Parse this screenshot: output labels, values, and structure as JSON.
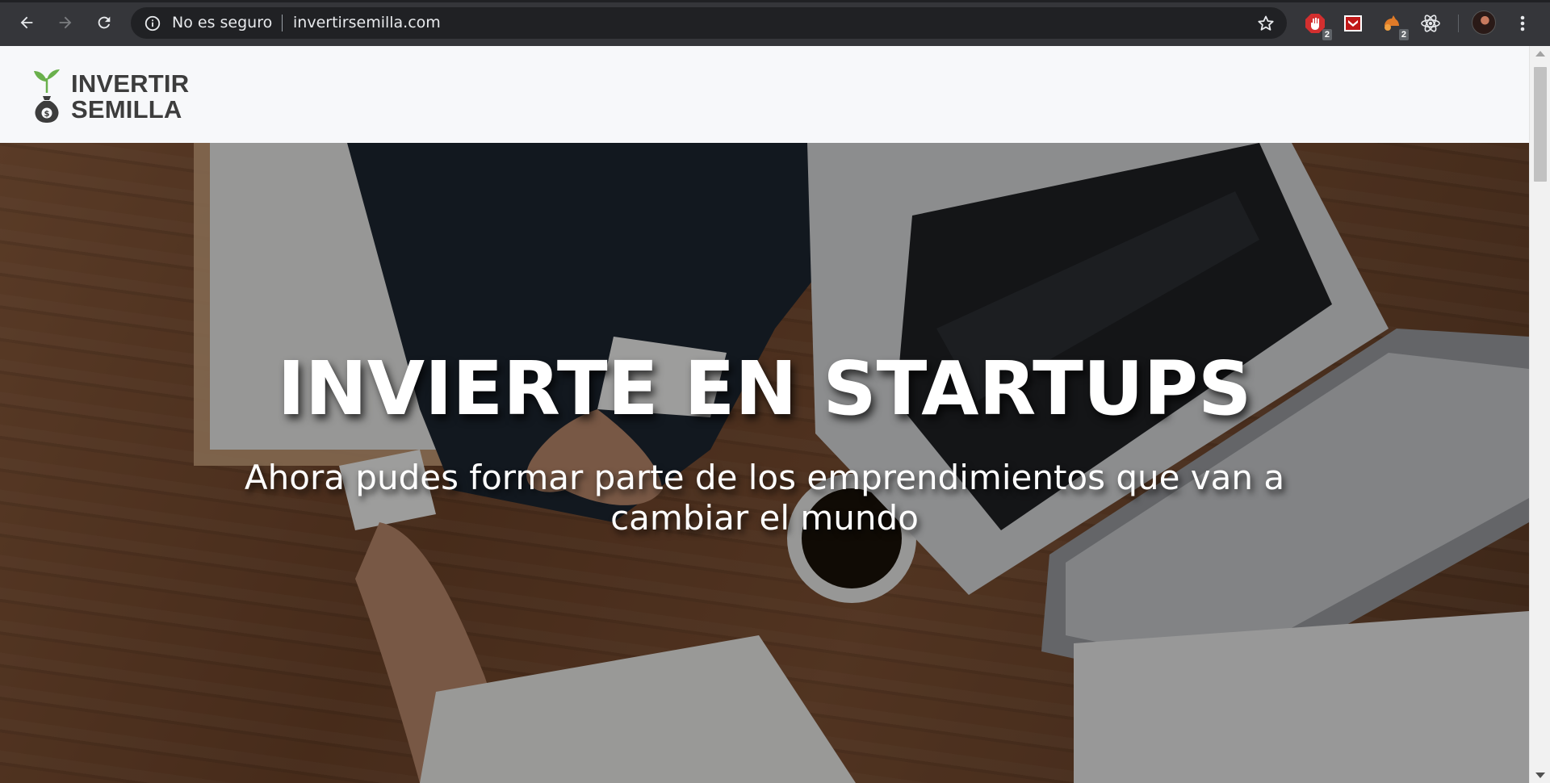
{
  "browser": {
    "security_label": "No es seguro",
    "url": "invertirsemilla.com",
    "extensions": [
      {
        "name": "adblock-icon",
        "badge": "2"
      },
      {
        "name": "mcafee-icon",
        "badge": ""
      },
      {
        "name": "extension-icon",
        "badge": "2"
      },
      {
        "name": "react-devtools-icon",
        "badge": ""
      }
    ]
  },
  "site": {
    "logo_line1": "INVERTIR",
    "logo_line2": "SEMILLA",
    "hero_title": "INVIERTE EN STARTUPS",
    "hero_subtitle": "Ahora pudes formar parte de los emprendimientos que van a cambiar el mundo"
  },
  "colors": {
    "chrome_bg": "#35363a",
    "omnibox_bg": "#202124",
    "page_bg": "#f7f8fa",
    "logo_text": "#3d3d3d",
    "logo_leaf": "#6ab04c",
    "hero_text": "#ffffff"
  }
}
